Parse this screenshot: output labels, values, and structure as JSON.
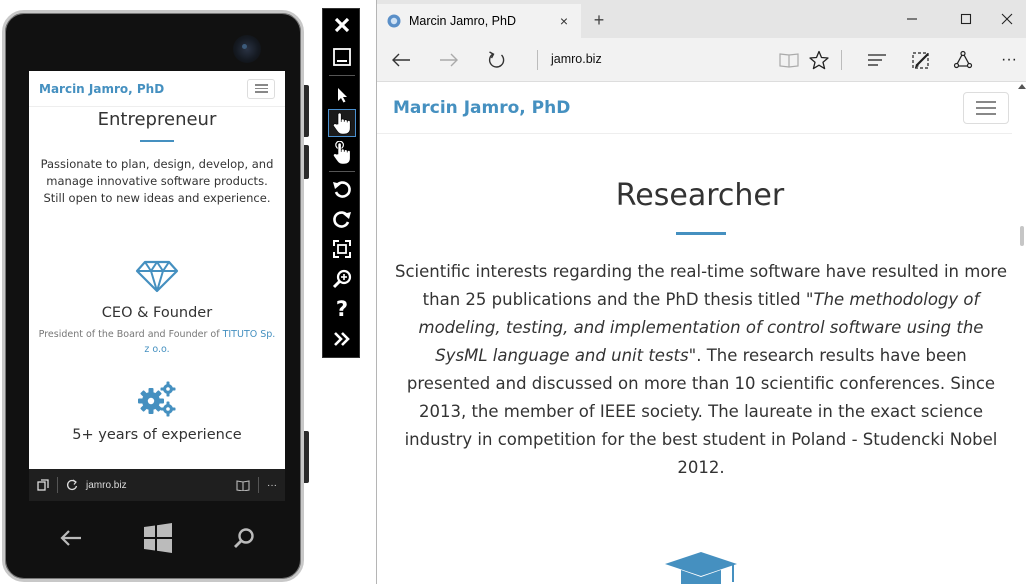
{
  "phone": {
    "brand": "Marcin Jamro, PhD",
    "heading": "Entrepreneur",
    "intro": "Passionate to plan, design, develop, and manage innovative software products. Still open to new ideas and experience.",
    "role_title": "CEO & Founder",
    "role_text": "President of the Board and Founder of ",
    "role_link": "TITUTO Sp. z o.o.",
    "experience_title": "5+ years of experience",
    "address_url": "jamro.biz",
    "address_more": "···",
    "icons": [
      "diamond-icon",
      "gears-icon",
      "back-icon",
      "windows-start-icon",
      "search-icon"
    ]
  },
  "toolbar": {
    "help_label": "?",
    "icons": [
      "close-icon",
      "minimize-icon",
      "pointer-icon",
      "single-touch-icon",
      "multi-touch-icon",
      "rotate-left-icon",
      "rotate-right-icon",
      "fit-to-screen-icon",
      "zoom-icon",
      "help-icon",
      "more-tools-icon"
    ]
  },
  "browser": {
    "tab_title": "Marcin Jamro, PhD",
    "tab_close": "×",
    "new_tab": "+",
    "url": "jamro.biz",
    "more_label": "···",
    "page": {
      "brand": "Marcin Jamro, PhD",
      "heading": "Researcher",
      "para_1": "Scientific interests regarding the real-time software have resulted in more than 25 publications and the PhD thesis titled \"",
      "para_thesis": "The methodology of modeling, testing, and implementation of control software using the SysML language and unit tests",
      "para_2": "\". The research results have been presented and discussed on more than 10 scientific conferences. Since 2013, the member of IEEE society. The laureate in the exact science industry in competition for the best student in Poland - Studencki Nobel 2012."
    }
  },
  "colors": {
    "accent": "#4590c0",
    "text": "#333333",
    "muted": "#777777",
    "toolbar_bg": "#000000",
    "toolbar_active": "#4a90d0",
    "chrome": "#f2f2f2"
  }
}
